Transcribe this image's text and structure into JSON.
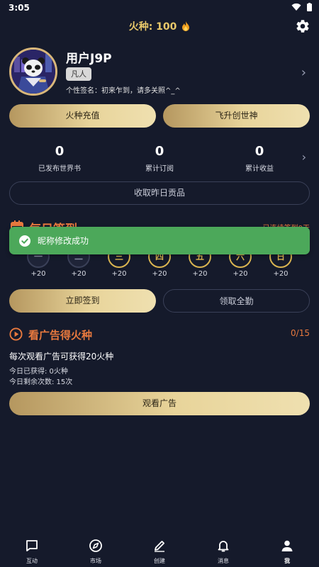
{
  "status_bar": {
    "time": "3:05"
  },
  "header": {
    "title": "火种: 100",
    "settings_icon": "gear-icon",
    "flame_icon": "flame-icon"
  },
  "profile": {
    "username": "用户J9P",
    "rank": "凡人",
    "signature": "个性签名：初来乍到，请多关照^_^"
  },
  "actions": {
    "recharge": "火种充值",
    "ascend": "飞升创世神"
  },
  "stats": [
    {
      "value": "0",
      "label": "已发布世界书"
    },
    {
      "value": "0",
      "label": "累计订阅"
    },
    {
      "value": "0",
      "label": "累计收益"
    }
  ],
  "collect_label": "收取昨日贡品",
  "daily_signin": {
    "title": "每日签到",
    "streak": "已连续签到0天",
    "days": [
      {
        "label": "一",
        "reward": "+20",
        "state": "dim"
      },
      {
        "label": "二",
        "reward": "+20",
        "state": "dim"
      },
      {
        "label": "三",
        "reward": "+20",
        "state": "gold"
      },
      {
        "label": "四",
        "reward": "+20",
        "state": "gold"
      },
      {
        "label": "五",
        "reward": "+20",
        "state": "gold"
      },
      {
        "label": "六",
        "reward": "+20",
        "state": "gold"
      },
      {
        "label": "日",
        "reward": "+20",
        "state": "gold"
      }
    ],
    "signin_button": "立即签到",
    "full_attendance_button": "领取全勤"
  },
  "toast": {
    "text": "昵称修改成功"
  },
  "ads": {
    "title": "看广告得火种",
    "counter": "0/15",
    "description": "每次观看广告可获得20火种",
    "earned": "今日已获得: 0火种",
    "remaining": "今日剩余次数: 15次",
    "button": "观看广告"
  },
  "bottom_nav": [
    {
      "label": "互动",
      "icon": "chat-icon",
      "active": false
    },
    {
      "label": "市场",
      "icon": "compass-icon",
      "active": false
    },
    {
      "label": "创建",
      "icon": "pencil-icon",
      "active": false
    },
    {
      "label": "消息",
      "icon": "bell-icon",
      "active": false
    },
    {
      "label": "我",
      "icon": "person-icon",
      "active": true
    }
  ],
  "colors": {
    "background": "#151a2b",
    "gold": "#e8c86a",
    "accent_orange": "#e8793e",
    "toast_green": "#4ca85a"
  }
}
